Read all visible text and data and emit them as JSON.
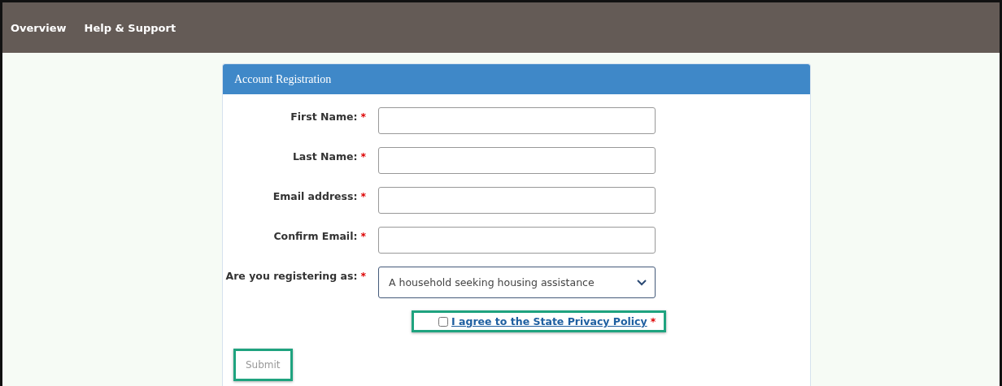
{
  "nav": {
    "items": [
      {
        "label": "Overview"
      },
      {
        "label": "Help & Support"
      }
    ]
  },
  "form": {
    "title": "Account Registration",
    "fields": [
      {
        "kind": "text",
        "label": "First Name:",
        "required_mark": "*"
      },
      {
        "kind": "text",
        "label": "Last Name:",
        "required_mark": "*"
      },
      {
        "kind": "text",
        "label": "Email address:",
        "required_mark": "*"
      },
      {
        "kind": "text",
        "label": "Confirm Email:",
        "required_mark": "*"
      },
      {
        "kind": "select",
        "label": "Are you registering as:",
        "required_mark": "*",
        "value": "A household seeking housing assistance"
      }
    ],
    "agreement": {
      "label": "I agree to the State Privacy Policy",
      "required_mark": "*",
      "checked": false,
      "highlighted": true
    },
    "submit": {
      "label": "Submit",
      "disabled": true,
      "highlighted": true
    }
  }
}
